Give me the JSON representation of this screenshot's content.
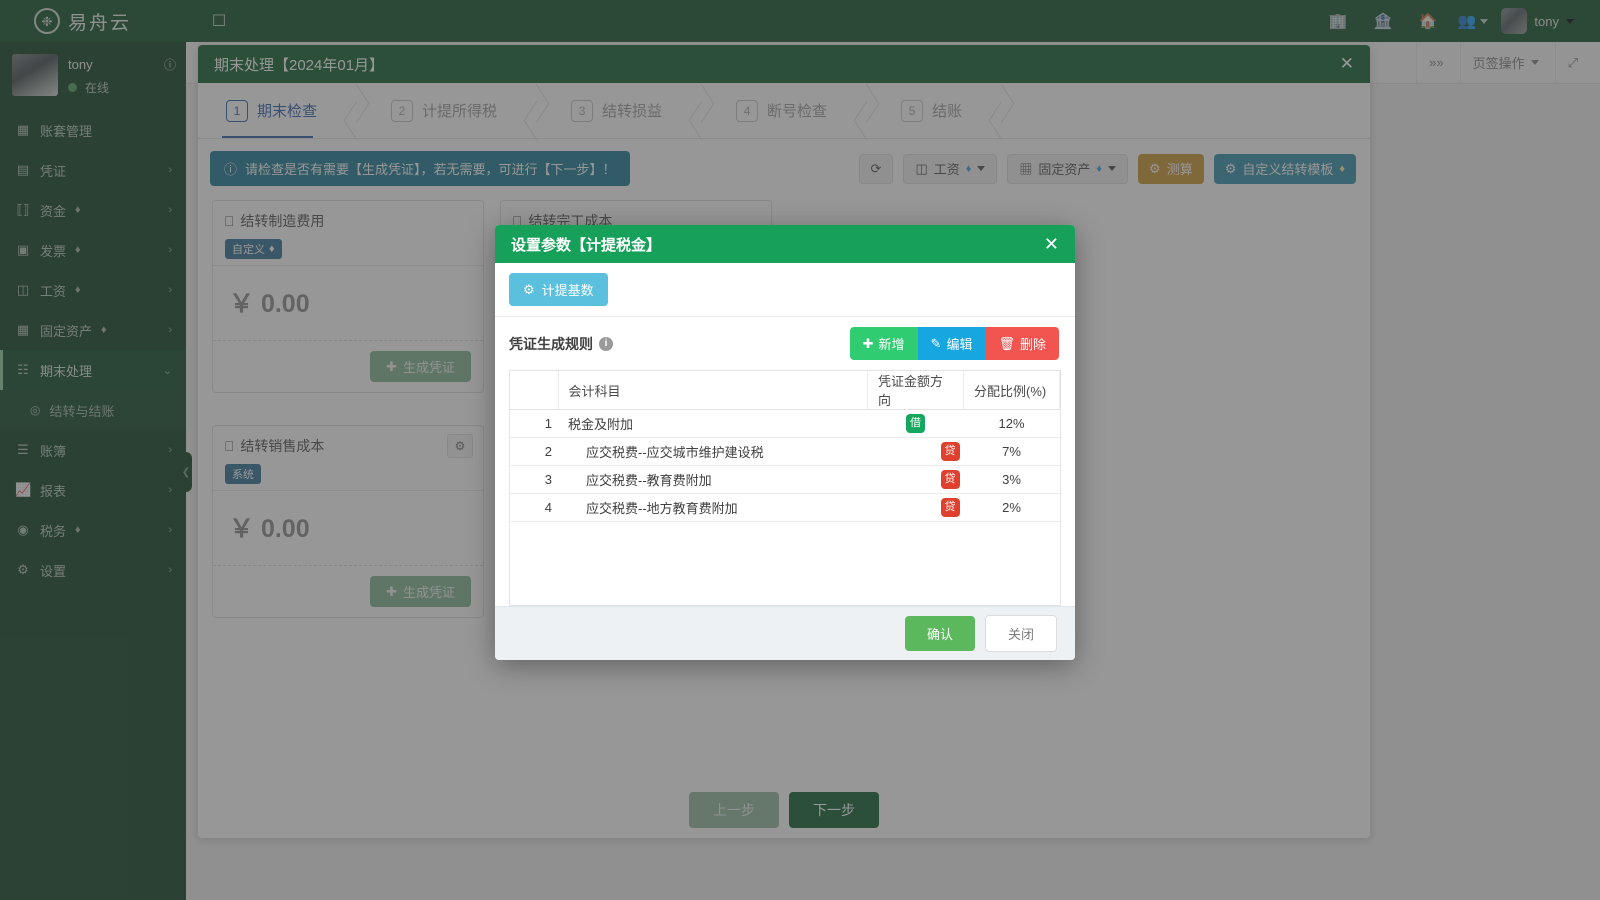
{
  "topbar": {
    "brand": "易舟云",
    "grid_icon": "grid-icon",
    "icons": [
      "building-icon",
      "bank-icon",
      "home-icon",
      "users-icon"
    ],
    "user_name": "tony"
  },
  "sidebar": {
    "user": {
      "name": "tony",
      "status": "在线",
      "info_icon": "info-icon"
    },
    "items": [
      {
        "label": "账套管理",
        "icon": "archive-icon",
        "gem": false,
        "arrow": false,
        "active": false
      },
      {
        "label": "凭证",
        "icon": "voucher-icon",
        "gem": false,
        "arrow": true,
        "active": false
      },
      {
        "label": "资金",
        "icon": "funds-icon",
        "gem": true,
        "arrow": true,
        "active": false
      },
      {
        "label": "发票",
        "icon": "invoice-icon",
        "gem": true,
        "arrow": true,
        "active": false
      },
      {
        "label": "工资",
        "icon": "salary-icon",
        "gem": true,
        "arrow": true,
        "active": false
      },
      {
        "label": "固定资产",
        "icon": "asset-icon",
        "gem": true,
        "arrow": true,
        "active": false
      },
      {
        "label": "期末处理",
        "icon": "calendar-icon",
        "gem": false,
        "arrow": true,
        "active": true
      }
    ],
    "sub_item": {
      "label": "结转与结账",
      "icon": "circle-icon"
    },
    "items_after": [
      {
        "label": "账簿",
        "icon": "book-icon",
        "gem": false,
        "arrow": true
      },
      {
        "label": "报表",
        "icon": "chart-icon",
        "gem": false,
        "arrow": true
      },
      {
        "label": "税务",
        "icon": "tax-icon",
        "gem": true,
        "arrow": true
      },
      {
        "label": "设置",
        "icon": "gear-icon",
        "gem": false,
        "arrow": true
      }
    ],
    "collapse_handle": "chevron-left-icon"
  },
  "tabbar": {
    "forward_icon": "double-chevron-right-icon",
    "tab_ops_label": "页签操作",
    "fullscreen_icon": "expand-icon"
  },
  "panel": {
    "title": "期末处理【2024年01月】",
    "close_icon": "close-icon",
    "steps": [
      {
        "num": "1",
        "label": "期末检查",
        "current": true
      },
      {
        "num": "2",
        "label": "计提所得税",
        "current": false
      },
      {
        "num": "3",
        "label": "结转损益",
        "current": false
      },
      {
        "num": "4",
        "label": "断号检查",
        "current": false
      },
      {
        "num": "5",
        "label": "结账",
        "current": false
      }
    ],
    "alert": "请检查是否有需要【生成凭证】，若无需要，可进行【下一步】！",
    "toolbar": {
      "refresh_icon": "refresh-icon",
      "salary_label": "工资",
      "asset_label": "固定资产",
      "calc_label": "测算",
      "template_label": "自定义结转模板"
    },
    "cards": [
      {
        "title": "结转制造费用",
        "tag": "自定义",
        "tag_gem": true,
        "amount": "￥ 0.00",
        "button": "生成凭证",
        "gear": false
      },
      {
        "title": "结转完工成本",
        "tag": "",
        "tag_gem": false,
        "amount": "",
        "button": "",
        "gear": false
      },
      {
        "title": "结转销售成本",
        "tag": "系统",
        "tag_gem": false,
        "amount": "￥ 0.00",
        "button": "生成凭证",
        "gear": true
      }
    ],
    "footer": {
      "prev": "上一步",
      "next": "下一步"
    }
  },
  "modal": {
    "title": "设置参数【计提税金】",
    "close_icon": "close-icon",
    "basis_tab": "计提基数",
    "rules_title": "凭证生成规则",
    "rules_info_icon": "info-icon",
    "actions": {
      "add": "新增",
      "edit": "编辑",
      "delete": "删除"
    },
    "table": {
      "headers": [
        "",
        "会计科目",
        "凭证金额方向",
        "分配比例(%)"
      ],
      "rows": [
        {
          "idx": "1",
          "subject": "税金及附加",
          "indent": false,
          "dir": "借",
          "dir_type": "debit",
          "pct": "12%"
        },
        {
          "idx": "2",
          "subject": "应交税费--应交城市维护建设税",
          "indent": true,
          "dir": "贷",
          "dir_type": "credit",
          "pct": "7%"
        },
        {
          "idx": "3",
          "subject": "应交税费--教育费附加",
          "indent": true,
          "dir": "贷",
          "dir_type": "credit",
          "pct": "3%"
        },
        {
          "idx": "4",
          "subject": "应交税费--地方教育费附加",
          "indent": true,
          "dir": "贷",
          "dir_type": "credit",
          "pct": "2%"
        }
      ]
    },
    "footer": {
      "ok": "确认",
      "close": "关闭"
    }
  },
  "colors": {
    "brand_green": "#0d4d25",
    "panel_green": "#0d5c2c",
    "modal_green": "#17a05a",
    "info_teal": "#17788f",
    "add_green": "#2fcc71",
    "edit_blue": "#16a6e0",
    "delete_red": "#f2544f",
    "badge_debit": "#16a75f",
    "badge_credit": "#e0412f"
  }
}
